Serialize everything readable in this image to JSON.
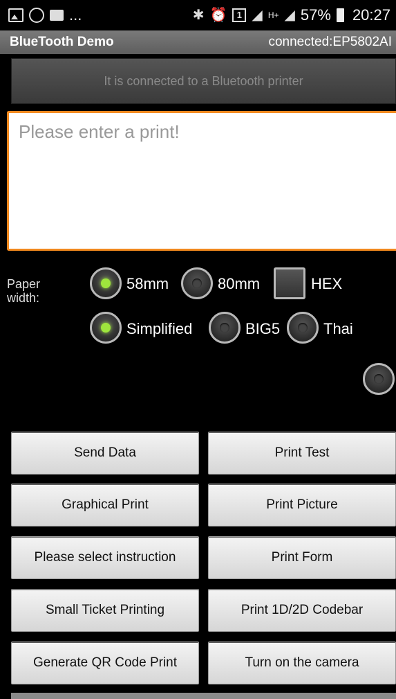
{
  "status_bar": {
    "left_more": "...",
    "sim_slot": "1",
    "network_type": "H+",
    "battery_percent": "57%",
    "time": "20:27",
    "icons": [
      "gallery-icon",
      "whatsapp-icon",
      "message-icon",
      "bluetooth-icon",
      "alarm-icon",
      "sim-icon",
      "signal-icon",
      "battery-icon"
    ]
  },
  "header": {
    "title": "BlueTooth Demo",
    "connection": "connected:EP5802AI"
  },
  "status_panel": {
    "text": "It is connected to a Bluetooth printer"
  },
  "print_input": {
    "placeholder": "Please enter a print!",
    "value": ""
  },
  "paper": {
    "label": "Paper width:",
    "options": [
      {
        "label": "58mm",
        "selected": true
      },
      {
        "label": "80mm",
        "selected": false
      }
    ],
    "hex_label": "HEX",
    "hex_checked": false
  },
  "encoding": {
    "options": [
      {
        "label": "Simplified",
        "selected": true
      },
      {
        "label": "BIG5",
        "selected": false
      },
      {
        "label": "Thai",
        "selected": false
      }
    ]
  },
  "buttons": [
    {
      "left": "Send Data",
      "right": "Print Test"
    },
    {
      "left": "Graphical Print",
      "right": "Print Picture"
    },
    {
      "left": "Please select instruction",
      "right": "Print Form"
    },
    {
      "left": "Small Ticket Printing",
      "right": "Print 1D/2D Codebar"
    },
    {
      "left": "Generate QR Code Print",
      "right": "Turn on the camera"
    }
  ]
}
